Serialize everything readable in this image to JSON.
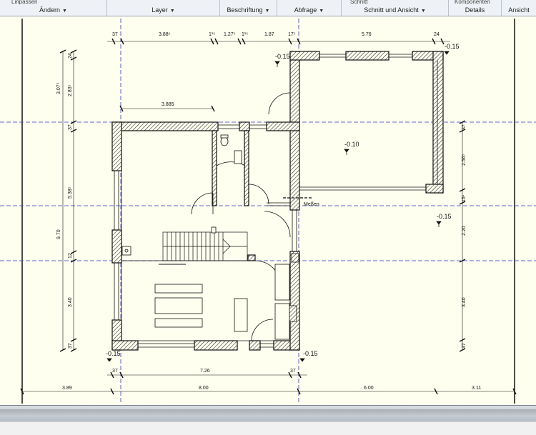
{
  "ribbon": {
    "groups": [
      {
        "label": "Ändern",
        "top_text": "Linpassen"
      },
      {
        "label": "Layer",
        "top_text": ""
      },
      {
        "label": "Beschriftung",
        "top_text": ""
      },
      {
        "label": "Abfrage",
        "top_text": ""
      },
      {
        "label": "Schnitt und Ansicht",
        "top_text": "Schnitt"
      },
      {
        "label": "Details",
        "top_text": "Komponenten"
      },
      {
        "label": "Ansicht",
        "top_text": ""
      }
    ],
    "dropdown_glyph": "▼"
  },
  "dims": {
    "top": [
      "37",
      "3.88⁵",
      "1¹⁵",
      "1.27⁵",
      "1¹⁵",
      "1.87",
      "17⁵",
      "5.76",
      "24"
    ],
    "inner_top": "3.885",
    "left": [
      "3.07⁵",
      "24",
      "2.83⁵",
      "37",
      "5.38⁵",
      "9.70",
      "12",
      "3.40",
      "37"
    ],
    "right": [
      "37",
      "2.56⁵",
      "15¹",
      "2.20",
      "3.40",
      "37"
    ],
    "bottom_inner": [
      "37",
      "7.26",
      "37"
    ],
    "bottom_outer": [
      "3.89",
      "8.00",
      "6.00",
      "3.11"
    ]
  },
  "levels": [
    "-0.15",
    "-0.10",
    "-0.15",
    "-0.15",
    "-0.15"
  ],
  "labels": {
    "meter": "Meßen"
  }
}
